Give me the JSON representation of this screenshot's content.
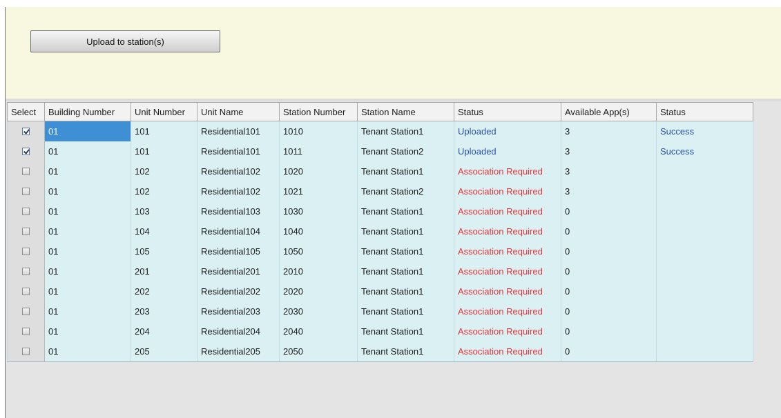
{
  "toolbar": {
    "upload_label": "Upload to station(s)"
  },
  "colors": {
    "top_panel_bg": "#f8f7df",
    "grid_row_bg": "#daf0f3",
    "uploaded_text": "#2a52a8",
    "association_required_text": "#e0353a",
    "success_text": "#2a52a8",
    "current_cell_bg": "#3f8fd4"
  },
  "table": {
    "columns": [
      "Select",
      "Building Number",
      "Unit Number",
      "Unit Name",
      "Station Number",
      "Station Name",
      "Status",
      "Available App(s)",
      "Status"
    ],
    "rows": [
      {
        "selected": true,
        "building": "01",
        "unit_number": "101",
        "unit_name": "Residential101",
        "station_number": "1010",
        "station_name": "Tenant Station1",
        "status": "Uploaded",
        "available_apps": "3",
        "result": "Success"
      },
      {
        "selected": true,
        "building": "01",
        "unit_number": "101",
        "unit_name": "Residential101",
        "station_number": "1011",
        "station_name": "Tenant Station2",
        "status": "Uploaded",
        "available_apps": "3",
        "result": "Success"
      },
      {
        "selected": false,
        "building": "01",
        "unit_number": "102",
        "unit_name": "Residential102",
        "station_number": "1020",
        "station_name": "Tenant Station1",
        "status": "Association Required",
        "available_apps": "3",
        "result": ""
      },
      {
        "selected": false,
        "building": "01",
        "unit_number": "102",
        "unit_name": "Residential102",
        "station_number": "1021",
        "station_name": "Tenant Station2",
        "status": "Association Required",
        "available_apps": "3",
        "result": ""
      },
      {
        "selected": false,
        "building": "01",
        "unit_number": "103",
        "unit_name": "Residential103",
        "station_number": "1030",
        "station_name": "Tenant Station1",
        "status": "Association Required",
        "available_apps": "0",
        "result": ""
      },
      {
        "selected": false,
        "building": "01",
        "unit_number": "104",
        "unit_name": "Residential104",
        "station_number": "1040",
        "station_name": "Tenant Station1",
        "status": "Association Required",
        "available_apps": "0",
        "result": ""
      },
      {
        "selected": false,
        "building": "01",
        "unit_number": "105",
        "unit_name": "Residential105",
        "station_number": "1050",
        "station_name": "Tenant Station1",
        "status": "Association Required",
        "available_apps": "0",
        "result": ""
      },
      {
        "selected": false,
        "building": "01",
        "unit_number": "201",
        "unit_name": "Residential201",
        "station_number": "2010",
        "station_name": "Tenant Station1",
        "status": "Association Required",
        "available_apps": "0",
        "result": ""
      },
      {
        "selected": false,
        "building": "01",
        "unit_number": "202",
        "unit_name": "Residential202",
        "station_number": "2020",
        "station_name": "Tenant Station1",
        "status": "Association Required",
        "available_apps": "0",
        "result": ""
      },
      {
        "selected": false,
        "building": "01",
        "unit_number": "203",
        "unit_name": "Residential203",
        "station_number": "2030",
        "station_name": "Tenant Station1",
        "status": "Association Required",
        "available_apps": "0",
        "result": ""
      },
      {
        "selected": false,
        "building": "01",
        "unit_number": "204",
        "unit_name": "Residential204",
        "station_number": "2040",
        "station_name": "Tenant Station1",
        "status": "Association Required",
        "available_apps": "0",
        "result": ""
      },
      {
        "selected": false,
        "building": "01",
        "unit_number": "205",
        "unit_name": "Residential205",
        "station_number": "2050",
        "station_name": "Tenant Station1",
        "status": "Association Required",
        "available_apps": "0",
        "result": ""
      }
    ]
  }
}
